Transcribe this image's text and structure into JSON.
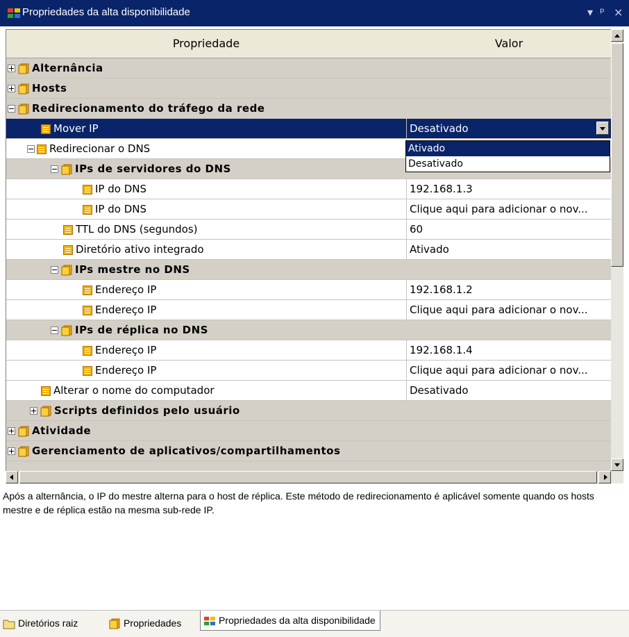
{
  "window": {
    "title": "Propriedades da alta disponibilidade",
    "pin_glyph": "▾",
    "dock_glyph": "ᵖ",
    "close_glyph": "×"
  },
  "grid": {
    "col_property": "Propriedade",
    "col_value": "Valor",
    "rows": [
      {
        "name": "Alternância",
        "value": ""
      },
      {
        "name": "Hosts",
        "value": ""
      },
      {
        "name": "Redirecionamento do tráfego da rede",
        "value": ""
      },
      {
        "name": "Mover IP",
        "value": "Desativado"
      },
      {
        "name": "Redirecionar o DNS",
        "value": ""
      },
      {
        "name": "IPs de servidores do DNS",
        "value": ""
      },
      {
        "name": "IP do DNS",
        "value": "192.168.1.3"
      },
      {
        "name": "IP do DNS",
        "value": "Clique aqui para adicionar o nov..."
      },
      {
        "name": "TTL do DNS (segundos)",
        "value": "60"
      },
      {
        "name": "Diretório ativo integrado",
        "value": "Ativado"
      },
      {
        "name": "IPs mestre no DNS",
        "value": ""
      },
      {
        "name": "Endereço IP",
        "value": "192.168.1.2"
      },
      {
        "name": "Endereço IP",
        "value": "Clique aqui para adicionar o nov..."
      },
      {
        "name": "IPs de réplica no DNS",
        "value": ""
      },
      {
        "name": "Endereço IP",
        "value": "192.168.1.4"
      },
      {
        "name": "Endereço IP",
        "value": "Clique aqui para adicionar o nov..."
      },
      {
        "name": "Alterar o nome do computador",
        "value": "Desativado"
      },
      {
        "name": "Scripts definidos pelo usuário",
        "value": ""
      },
      {
        "name": "Atividade",
        "value": ""
      },
      {
        "name": "Gerenciamento de aplicativos/compartilhamentos",
        "value": ""
      }
    ],
    "dropdown_options": [
      "Ativado",
      "Desativado"
    ]
  },
  "description": "Após a alternância, o IP do mestre alterna para o host de réplica. Este método de redirecionamento é aplicável somente quando os hosts mestre e de réplica estão na mesma sub-rede IP.",
  "tabs": [
    "Diretórios raiz",
    "Propriedades",
    "Propriedades da alta disponibilidade"
  ],
  "colors": {
    "title_bar": "#0a246a",
    "selection": "#0a246a",
    "grid_bg": "#d4d0c8",
    "icon": "#f0b000"
  }
}
